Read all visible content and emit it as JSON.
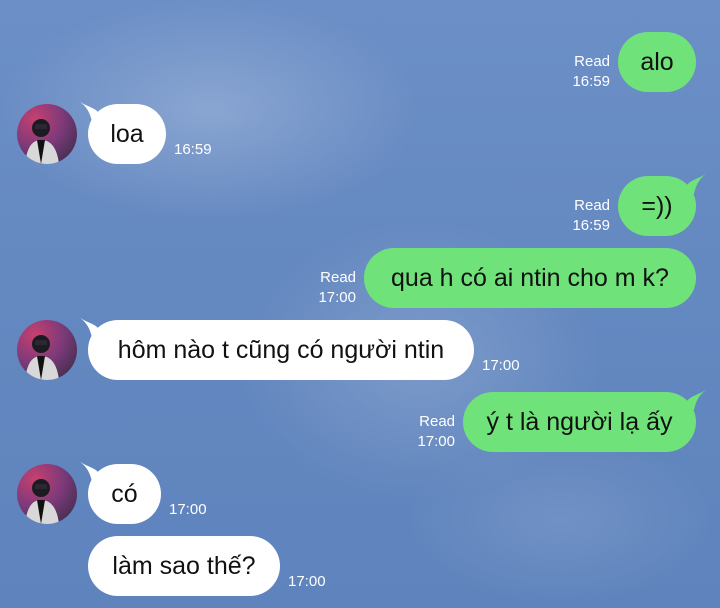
{
  "messages": [
    {
      "id": "m1",
      "direction": "outgoing",
      "text": "alo",
      "read_label": "Read",
      "time": "16:59"
    },
    {
      "id": "m2",
      "direction": "incoming",
      "text": "loa",
      "time": "16:59"
    },
    {
      "id": "m3",
      "direction": "outgoing",
      "text": "=))",
      "read_label": "Read",
      "time": "16:59"
    },
    {
      "id": "m4",
      "direction": "outgoing",
      "text": "qua h có ai ntin cho m k?",
      "read_label": "Read",
      "time": "17:00"
    },
    {
      "id": "m5",
      "direction": "incoming",
      "text": "hôm nào t cũng có người ntin",
      "time": "17:00"
    },
    {
      "id": "m6",
      "direction": "outgoing",
      "text": "ý t là người lạ ấy",
      "read_label": "Read",
      "time": "17:00"
    },
    {
      "id": "m7",
      "direction": "incoming",
      "text": "có",
      "time": "17:00"
    },
    {
      "id": "m8",
      "direction": "incoming",
      "text": "làm sao thế?",
      "time": "17:00"
    }
  ],
  "colors": {
    "outgoing_bubble": "#6fe27a",
    "incoming_bubble": "#ffffff",
    "background": "#6488c0"
  },
  "avatar": {
    "icon": "profile-photo-avatar"
  }
}
